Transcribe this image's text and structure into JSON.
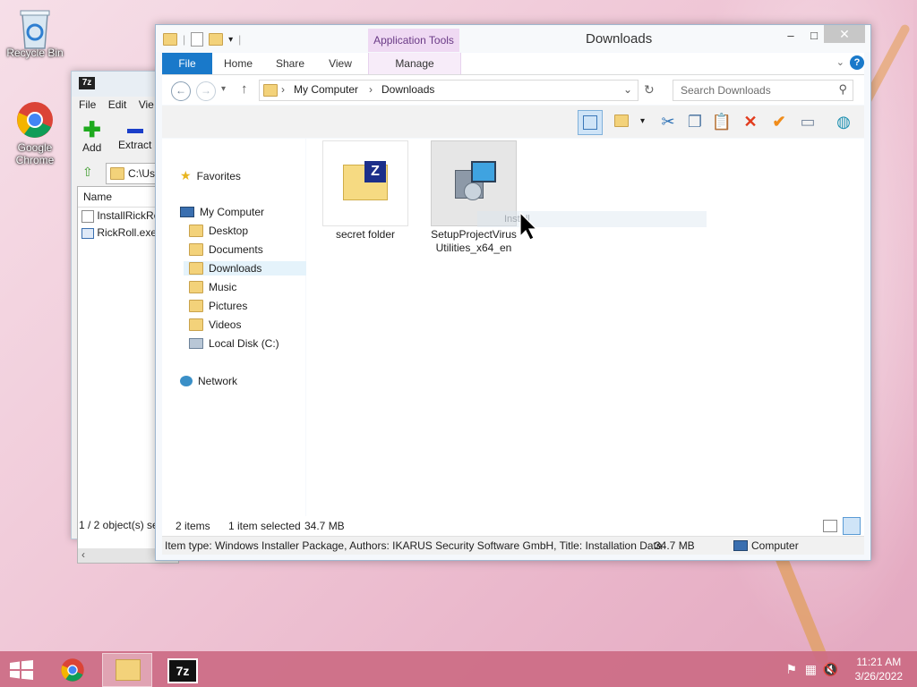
{
  "desktop": {
    "icons": [
      {
        "label": "Recycle Bin"
      },
      {
        "label": "Google Chrome"
      }
    ]
  },
  "sevenzip": {
    "app_icon": "7z",
    "menu": [
      "File",
      "Edit",
      "Vie"
    ],
    "toolbar": {
      "add": "Add",
      "extract": "Extract"
    },
    "address": "C:\\Us",
    "column_name": "Name",
    "files": [
      "InstallRickRo",
      "RickRoll.exe"
    ],
    "status": "1 / 2 object(s) se"
  },
  "explorer": {
    "title": "Downloads",
    "contextual_group": "Application Tools",
    "tabs": [
      "File",
      "Home",
      "Share",
      "View",
      "Manage"
    ],
    "breadcrumb": [
      "My Computer",
      "Downloads"
    ],
    "search_placeholder": "Search Downloads",
    "nav": {
      "favorites": "Favorites",
      "my_computer": "My Computer",
      "children": [
        "Desktop",
        "Documents",
        "Downloads",
        "Music",
        "Pictures",
        "Videos",
        "Local Disk (C:)"
      ],
      "network": "Network"
    },
    "items": [
      {
        "name": "secret folder"
      },
      {
        "name": "SetupProjectVirus Utilities_x64_en"
      }
    ],
    "status": {
      "items": "2 items",
      "selected": "1 item selected",
      "size": "34.7 MB"
    },
    "details": {
      "text": "Item type: Windows Installer Package, Authors: IKARUS Security Software GmbH, Title: Installation Data",
      "size": "34.7 MB",
      "location": "Computer"
    },
    "drag_hint": "Install"
  },
  "taskbar": {
    "clock_time": "11:21 AM",
    "clock_date": "3/26/2022"
  },
  "colors": {
    "file_tab": "#1979ca",
    "app_tools": "#efd9f3",
    "taskbar": "#cc6b84"
  }
}
